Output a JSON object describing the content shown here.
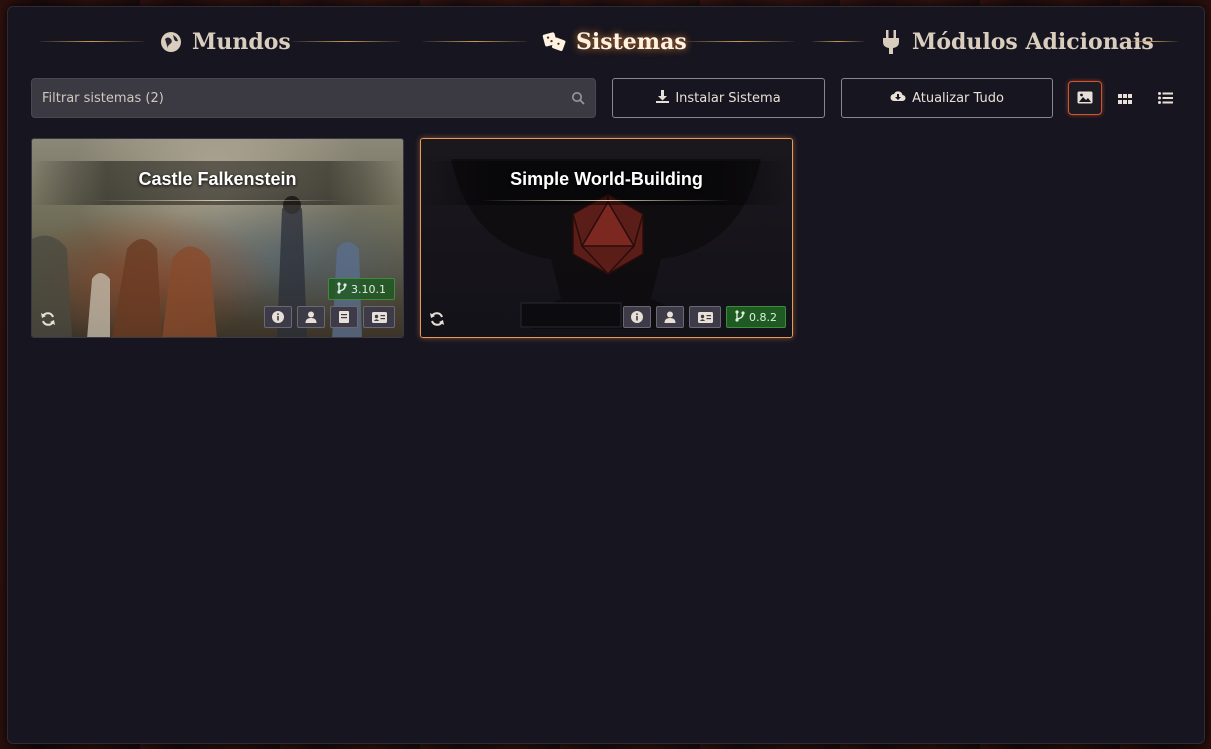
{
  "tabs": [
    {
      "label": "Mundos",
      "icon": "globe-icon",
      "active": false
    },
    {
      "label": "Sistemas",
      "icon": "dice-icon",
      "active": true
    },
    {
      "label": "Módulos Adicionais",
      "icon": "plug-icon",
      "active": false
    }
  ],
  "search": {
    "placeholder": "Filtrar sistemas (2)"
  },
  "buttons": {
    "install": "Instalar Sistema",
    "update_all": "Atualizar Tudo"
  },
  "view_modes": [
    "image-view-icon",
    "grid-view-icon",
    "list-view-icon"
  ],
  "systems": [
    {
      "title": "Castle Falkenstein",
      "version": "3.10.1",
      "selected": false,
      "tags": [
        "info-icon",
        "author-icon",
        "manual-icon",
        "id-card-icon"
      ]
    },
    {
      "title": "Simple World-Building",
      "version": "0.8.2",
      "selected": true,
      "tags": [
        "info-icon",
        "author-icon",
        "id-card-icon"
      ]
    }
  ],
  "colors": {
    "accent": "#e89a5a",
    "version_bg": "#1f5a22",
    "panel": "#17151f"
  }
}
